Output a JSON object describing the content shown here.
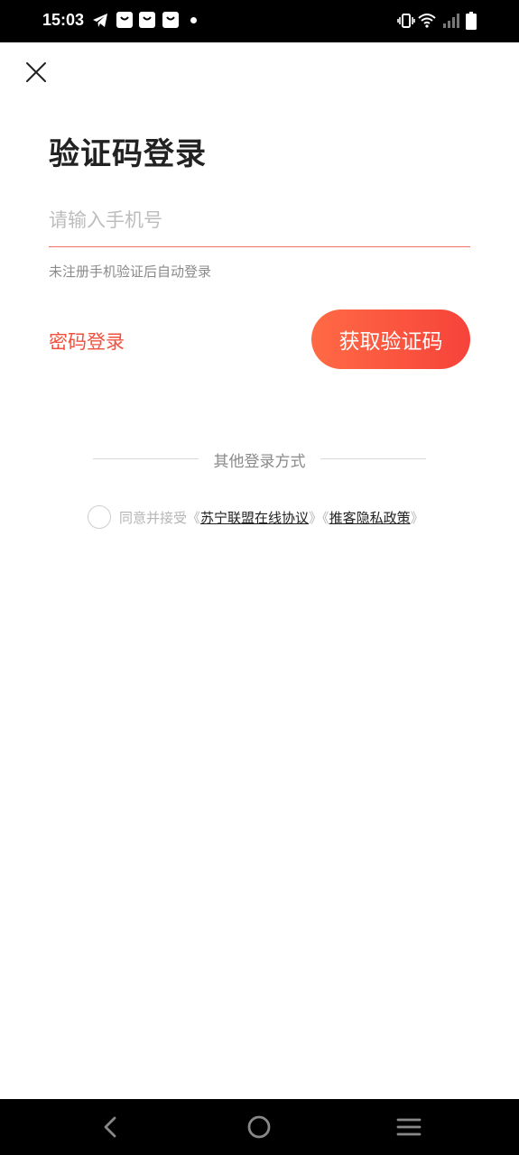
{
  "status_bar": {
    "time": "15:03",
    "icons": [
      "telegram-icon",
      "shopping-bag-icon",
      "shopping-bag-icon",
      "shopping-bag-icon",
      "notification-dot-icon",
      "vibrate-icon",
      "wifi-icon",
      "signal-icon",
      "battery-icon"
    ]
  },
  "header": {
    "close_icon": "close-icon"
  },
  "main": {
    "title": "验证码登录",
    "phone_placeholder": "请输入手机号",
    "phone_value": "",
    "hint": "未注册手机验证后自动登录",
    "password_login_label": "密码登录",
    "get_code_label": "获取验证码",
    "other_login_label": "其他登录方式",
    "agreement": {
      "prefix": "同意并接受",
      "open1": "《",
      "link1": "苏宁联盟在线协议",
      "mid": "》《",
      "link2": "推客隐私政策",
      "close2": "》"
    }
  },
  "colors": {
    "accent": "#f0503c",
    "button_gradient_start": "#ff6a45",
    "button_gradient_end": "#f6433a"
  },
  "nav_bar": {
    "icons": [
      "back-icon",
      "home-icon",
      "menu-icon"
    ]
  }
}
